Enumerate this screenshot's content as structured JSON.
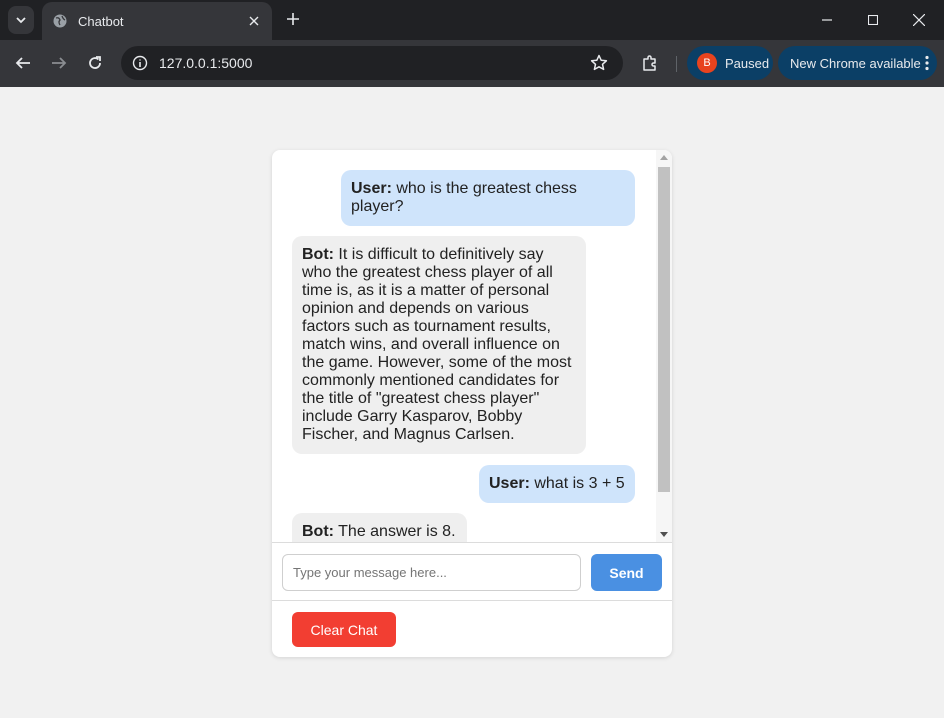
{
  "browser": {
    "tab_title": "Chatbot",
    "url": "127.0.0.1:5000",
    "profile_initial": "B",
    "profile_status": "Paused",
    "update_label": "New Chrome available"
  },
  "chat": {
    "messages": [
      {
        "role": "user",
        "speaker": "User:",
        "text": " who is the greatest chess player?"
      },
      {
        "role": "bot",
        "speaker": "Bot:",
        "text": " It is difficult to definitively say who the greatest chess player of all time is, as it is a matter of personal opinion and depends on various factors such as tournament results, match wins, and overall influence on the game. However, some of the most commonly mentioned candidates for the title of \"greatest chess player\" include Garry Kasparov, Bobby Fischer, and Magnus Carlsen."
      },
      {
        "role": "user",
        "speaker": "User:",
        "text": " what is 3 + 5"
      },
      {
        "role": "bot",
        "speaker": "Bot:",
        "text": " The answer is 8."
      }
    ],
    "input_placeholder": "Type your message here...",
    "send_label": "Send",
    "clear_label": "Clear Chat"
  },
  "colors": {
    "user_bubble": "#cfe4fb",
    "bot_bubble": "#efefef",
    "send_button": "#4a90e2",
    "clear_button": "#f23e32"
  }
}
